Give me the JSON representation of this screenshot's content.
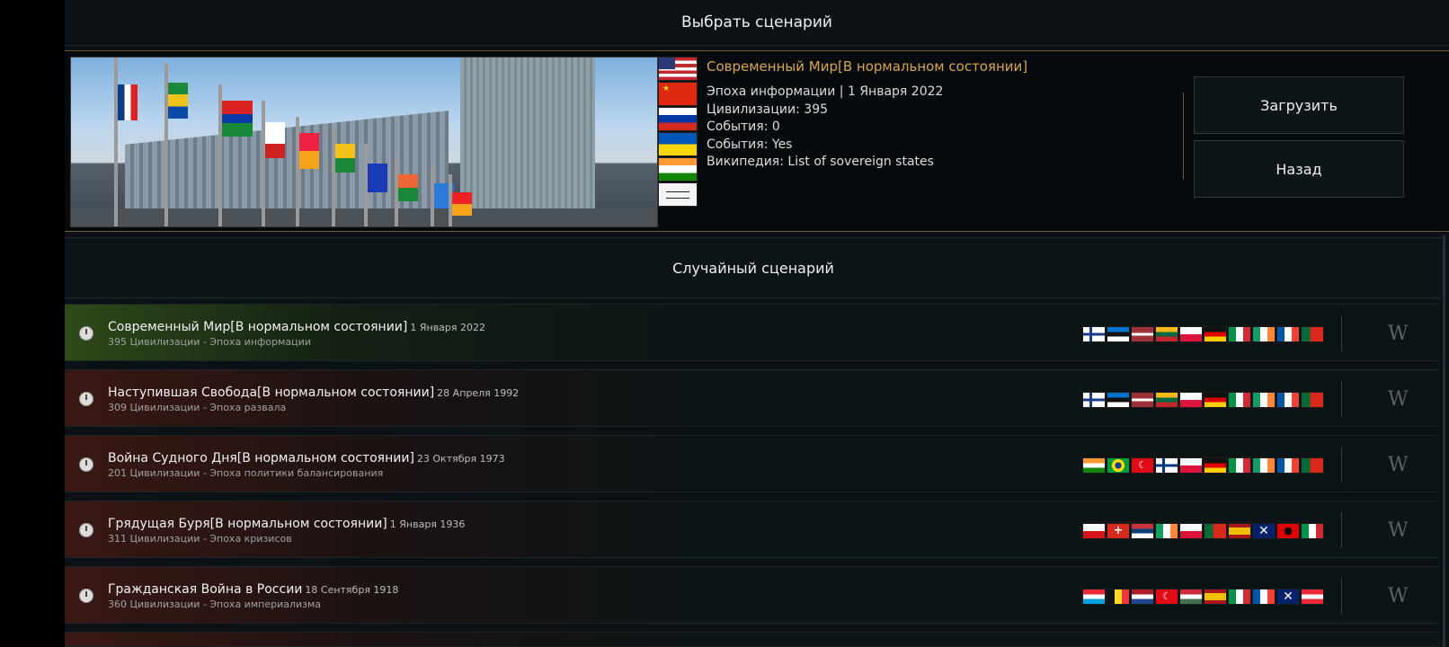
{
  "header": {
    "title": "Выбрать сценарий"
  },
  "featured": {
    "title": "Современный Мир[В нормальном состоянии]",
    "era_line": "Эпоха информации | 1 Января 2022",
    "civs_line": "Цивилизации: 395",
    "events_count_line": "События: 0",
    "events_line": "События: Yes",
    "wiki_line": "Википедия: List of sovereign states",
    "flags": [
      "usa-flag",
      "china-flag",
      "russia-flag",
      "ukraine-flag",
      "india-flag",
      "taliban-flag"
    ]
  },
  "buttons": {
    "load": "Загрузить",
    "back": "Назад"
  },
  "random_label": "Случайный сценарий",
  "scenarios": [
    {
      "title": "Современный Мир[В нормальном состоянии]",
      "date": "1 Января 2022",
      "subtitle": "395 Цивилизации - Эпоха информации",
      "tint": "green"
    },
    {
      "title": "Наступившая Свобода[В нормальном состоянии]",
      "date": "28 Апреля 1992",
      "subtitle": "309 Цивилизации - Эпоха развала",
      "tint": "red"
    },
    {
      "title": "Война Судного Дня[В нормальном состоянии]",
      "date": "23 Октября 1973",
      "subtitle": "201 Цивилизации - Эпоха политики балансирования",
      "tint": "red"
    },
    {
      "title": "Грядущая Буря[В нормальном состоянии]",
      "date": "1 Января 1936",
      "subtitle": "311 Цивилизации - Эпоха кризисов",
      "tint": "red"
    },
    {
      "title": "Гражданская Война в России",
      "date": "18 Сентября 1918",
      "subtitle": "360 Цивилизации - Эпоха империализма",
      "tint": "red"
    }
  ],
  "wiki_icon": "W"
}
